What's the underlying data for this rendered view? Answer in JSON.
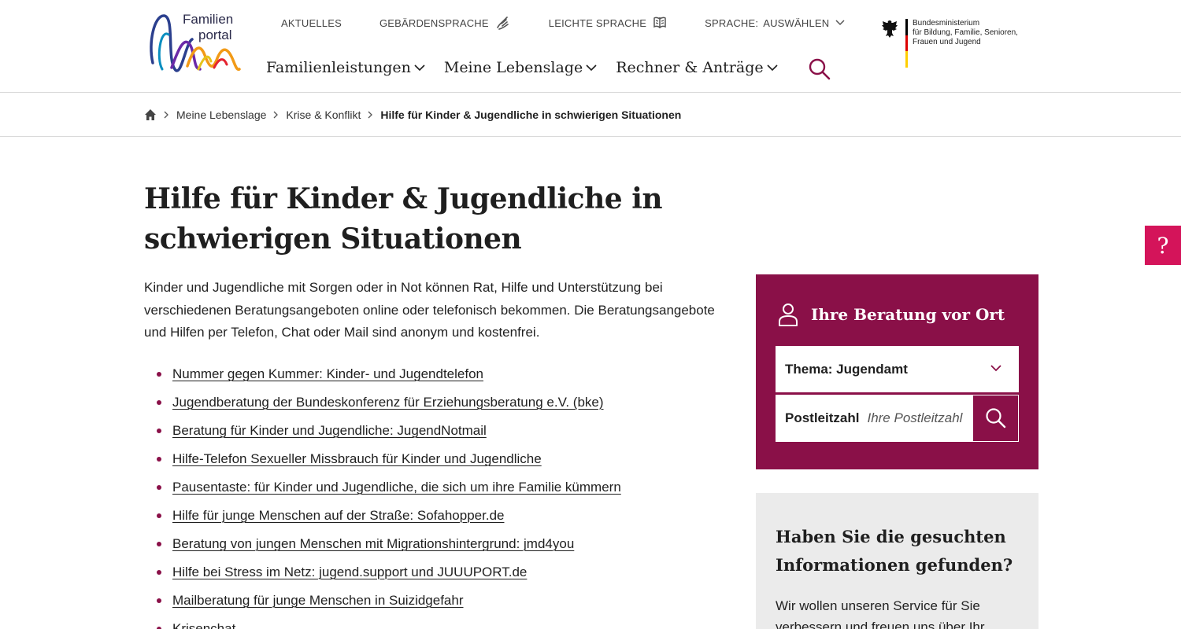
{
  "header": {
    "logo": {
      "line1": "Familien",
      "line2": "portal"
    },
    "meta_nav": {
      "aktuelles": "AKTUELLES",
      "gebaerdensprache": "GEBÄRDENSPRACHE",
      "leichte_sprache": "LEICHTE SPRACHE",
      "sprache_label": "SPRACHE:",
      "sprache_value": "AUSWÄHLEN"
    },
    "main_nav": [
      {
        "label": "Familienleistungen"
      },
      {
        "label": "Meine Lebenslage"
      },
      {
        "label": "Rechner & Anträge"
      }
    ],
    "ministry": {
      "lines": [
        "Bundesministerium",
        "für Bildung, Familie, Senioren,",
        "Frauen und Jugend"
      ],
      "flag_colors": [
        "#000000",
        "#dd0000",
        "#ffce00"
      ]
    }
  },
  "breadcrumb": {
    "items": [
      "Meine Lebenslage",
      "Krise & Konflikt"
    ],
    "current": "Hilfe für Kinder & Jugendliche in schwierigen Situationen"
  },
  "main": {
    "title": "Hilfe für Kinder & Jugendliche in schwierigen Situationen",
    "intro": "Kinder und Jugendliche mit Sorgen oder in Not können Rat, Hilfe und Unterstützung bei verschiedenen Beratungsangeboten online oder telefonisch bekommen. Die Beratungsangebote und Hilfen per Telefon, Chat oder Mail sind anonym und kostenfrei.",
    "links": [
      "Nummer gegen Kummer: Kinder- und Jugendtelefon",
      "Jugendberatung der Bundeskonferenz für Erziehungsberatung e.V. (bke)",
      "Beratung für Kinder und Jugendliche: JugendNotmail",
      "Hilfe-Telefon Sexueller Missbrauch für Kinder und Jugendliche",
      "Pausentaste: für Kinder und Jugendliche, die sich um ihre Familie kümmern",
      "Hilfe für junge Menschen auf der Straße: Sofahopper.de",
      "Beratung von jungen Menschen mit Migrationshintergrund: jmd4you",
      "Hilfe bei Stress im Netz: jugend.support und JUUUPORT.de",
      "Mailberatung für junge Menschen in Suizidgefahr",
      "Krisenchat"
    ]
  },
  "sidebar": {
    "beratung": {
      "title": "Ihre Beratung vor Ort",
      "thema": "Thema: Jugendamt",
      "plz_label": "Postleitzahl",
      "plz_placeholder": "Ihre Postleitzahl"
    },
    "feedback": {
      "title": "Haben Sie die gesuchten Informationen gefunden?",
      "text": "Wir wollen unseren Service für Sie verbessern und freuen uns über Ihr"
    },
    "help_label": "?"
  },
  "colors": {
    "accent": "#8a1048",
    "help": "#d4145a",
    "feedback_bg": "#ebebeb"
  }
}
